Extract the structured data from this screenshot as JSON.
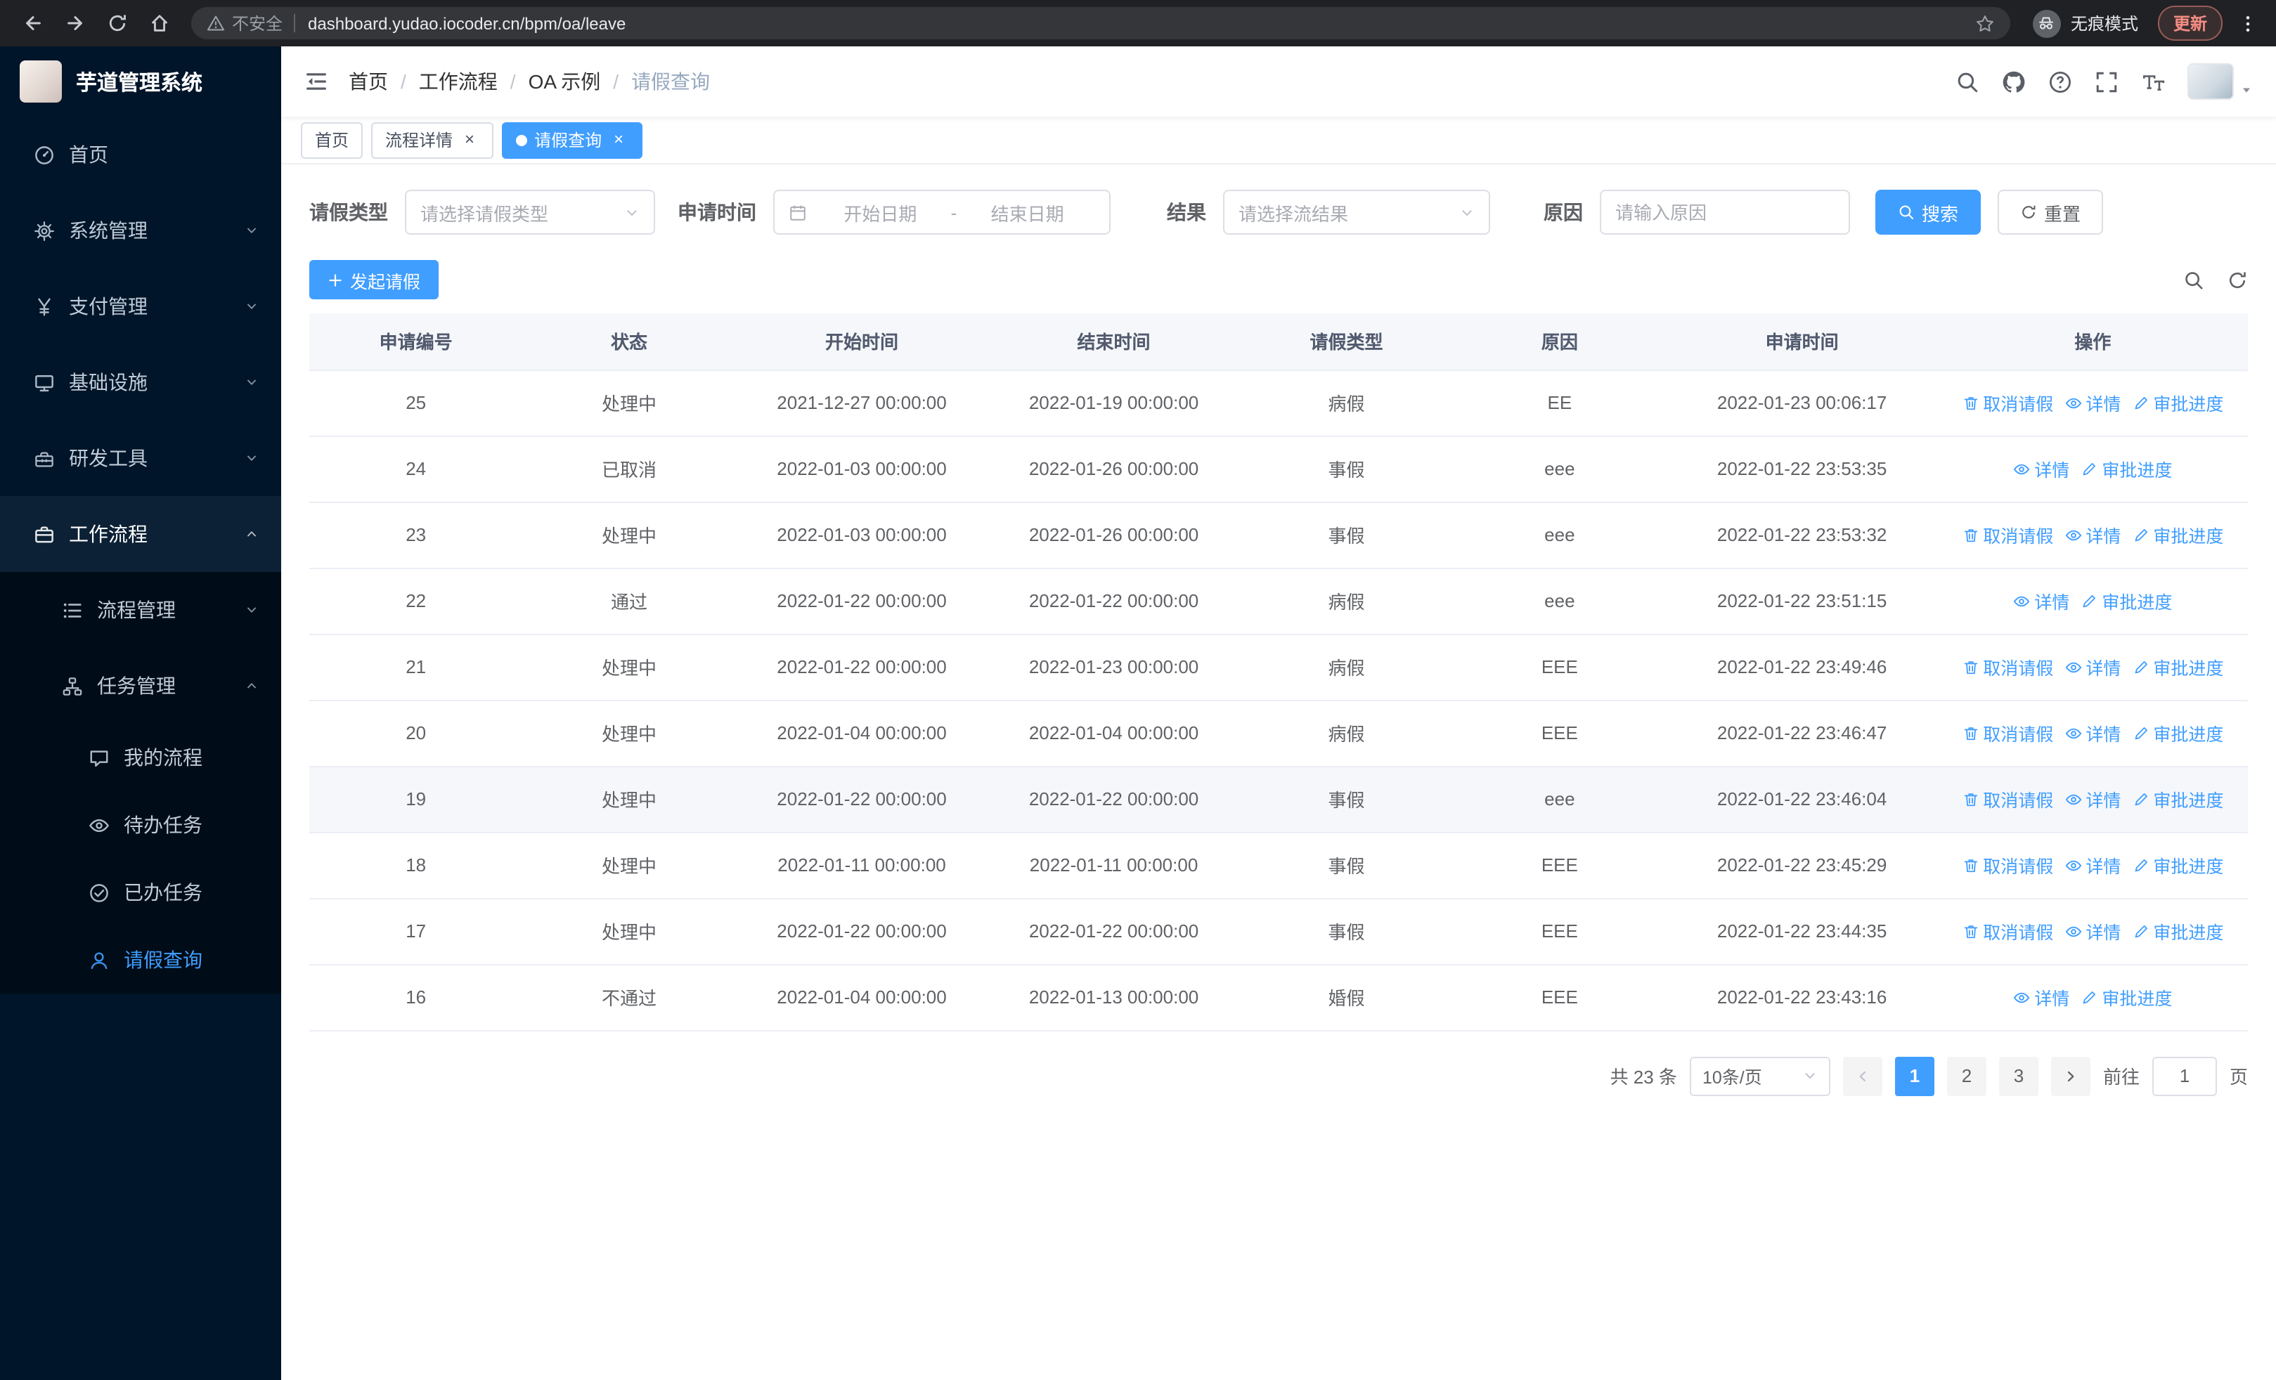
{
  "browser": {
    "security_label": "不安全",
    "url": "dashboard.yudao.iocoder.cn/bpm/oa/leave",
    "incognito_label": "无痕模式",
    "update_label": "更新"
  },
  "sidebar": {
    "brand": "芋道管理系统",
    "items": [
      {
        "id": "home",
        "label": "首页",
        "icon": "dashboard",
        "level": 1
      },
      {
        "id": "system",
        "label": "系统管理",
        "icon": "gear",
        "level": 1,
        "chevron": "down"
      },
      {
        "id": "payment",
        "label": "支付管理",
        "icon": "yen",
        "level": 1,
        "chevron": "down"
      },
      {
        "id": "infrastructure",
        "label": "基础设施",
        "icon": "infra",
        "level": 1,
        "chevron": "down"
      },
      {
        "id": "devtools",
        "label": "研发工具",
        "icon": "tools",
        "level": 1,
        "chevron": "down"
      },
      {
        "id": "workflow",
        "label": "工作流程",
        "icon": "workflow",
        "level": 1,
        "chevron": "up",
        "open": true
      },
      {
        "id": "process-mgmt",
        "label": "流程管理",
        "icon": "process",
        "level": 2,
        "chevron": "down"
      },
      {
        "id": "task-mgmt",
        "label": "任务管理",
        "icon": "task",
        "level": 2,
        "chevron": "up"
      },
      {
        "id": "my-process",
        "label": "我的流程",
        "icon": "chat",
        "level": 3
      },
      {
        "id": "todo-task",
        "label": "待办任务",
        "icon": "eye",
        "level": 3
      },
      {
        "id": "done-task",
        "label": "已办任务",
        "icon": "done",
        "level": 3
      },
      {
        "id": "leave-query",
        "label": "请假查询",
        "icon": "user",
        "level": 3,
        "active": true
      }
    ]
  },
  "navbar": {
    "breadcrumb": [
      "首页",
      "工作流程",
      "OA 示例",
      "请假查询"
    ]
  },
  "tabs": [
    {
      "id": "home",
      "label": "首页",
      "closable": false,
      "active": false
    },
    {
      "id": "process-detail",
      "label": "流程详情",
      "closable": true,
      "active": false
    },
    {
      "id": "leave-query",
      "label": "请假查询",
      "closable": true,
      "active": true
    }
  ],
  "filters": {
    "leave_type_label": "请假类型",
    "leave_type_placeholder": "请选择请假类型",
    "apply_time_label": "申请时间",
    "start_placeholder": "开始日期",
    "range_separator": "-",
    "end_placeholder": "结束日期",
    "result_label": "结果",
    "result_placeholder": "请选择流结果",
    "reason_label": "原因",
    "reason_placeholder": "请输入原因",
    "search_label": "搜索",
    "reset_label": "重置"
  },
  "toolbar": {
    "create_label": "发起请假"
  },
  "table": {
    "columns": [
      "申请编号",
      "状态",
      "开始时间",
      "结束时间",
      "请假类型",
      "原因",
      "申请时间",
      "操作"
    ],
    "action_labels": {
      "cancel": "取消请假",
      "detail": "详情",
      "progress": "审批进度"
    },
    "action_icons": {
      "cancel": "delete-icon",
      "detail": "eye-icon",
      "progress": "edit-icon"
    },
    "rows": [
      {
        "id": "25",
        "status": "处理中",
        "start": "2021-12-27 00:00:00",
        "end": "2022-01-19 00:00:00",
        "type": "病假",
        "reason": "EE",
        "apply_time": "2022-01-23 00:06:17",
        "actions": [
          "cancel",
          "detail",
          "progress"
        ]
      },
      {
        "id": "24",
        "status": "已取消",
        "start": "2022-01-03 00:00:00",
        "end": "2022-01-26 00:00:00",
        "type": "事假",
        "reason": "eee",
        "apply_time": "2022-01-22 23:53:35",
        "actions": [
          "detail",
          "progress"
        ]
      },
      {
        "id": "23",
        "status": "处理中",
        "start": "2022-01-03 00:00:00",
        "end": "2022-01-26 00:00:00",
        "type": "事假",
        "reason": "eee",
        "apply_time": "2022-01-22 23:53:32",
        "actions": [
          "cancel",
          "detail",
          "progress"
        ]
      },
      {
        "id": "22",
        "status": "通过",
        "start": "2022-01-22 00:00:00",
        "end": "2022-01-22 00:00:00",
        "type": "病假",
        "reason": "eee",
        "apply_time": "2022-01-22 23:51:15",
        "actions": [
          "detail",
          "progress"
        ]
      },
      {
        "id": "21",
        "status": "处理中",
        "start": "2022-01-22 00:00:00",
        "end": "2022-01-23 00:00:00",
        "type": "病假",
        "reason": "EEE",
        "apply_time": "2022-01-22 23:49:46",
        "actions": [
          "cancel",
          "detail",
          "progress"
        ]
      },
      {
        "id": "20",
        "status": "处理中",
        "start": "2022-01-04 00:00:00",
        "end": "2022-01-04 00:00:00",
        "type": "病假",
        "reason": "EEE",
        "apply_time": "2022-01-22 23:46:47",
        "actions": [
          "cancel",
          "detail",
          "progress"
        ]
      },
      {
        "id": "19",
        "status": "处理中",
        "start": "2022-01-22 00:00:00",
        "end": "2022-01-22 00:00:00",
        "type": "事假",
        "reason": "eee",
        "apply_time": "2022-01-22 23:46:04",
        "actions": [
          "cancel",
          "detail",
          "progress"
        ],
        "highlighted": true
      },
      {
        "id": "18",
        "status": "处理中",
        "start": "2022-01-11 00:00:00",
        "end": "2022-01-11 00:00:00",
        "type": "事假",
        "reason": "EEE",
        "apply_time": "2022-01-22 23:45:29",
        "actions": [
          "cancel",
          "detail",
          "progress"
        ]
      },
      {
        "id": "17",
        "status": "处理中",
        "start": "2022-01-22 00:00:00",
        "end": "2022-01-22 00:00:00",
        "type": "事假",
        "reason": "EEE",
        "apply_time": "2022-01-22 23:44:35",
        "actions": [
          "cancel",
          "detail",
          "progress"
        ]
      },
      {
        "id": "16",
        "status": "不通过",
        "start": "2022-01-04 00:00:00",
        "end": "2022-01-13 00:00:00",
        "type": "婚假",
        "reason": "EEE",
        "apply_time": "2022-01-22 23:43:16",
        "actions": [
          "detail",
          "progress"
        ]
      }
    ]
  },
  "pagination": {
    "total_label": "共 23 条",
    "page_size_label": "10条/页",
    "pages": [
      "1",
      "2",
      "3"
    ],
    "active_page": "1",
    "goto_label": "前往",
    "goto_value": "1",
    "page_unit_label": "页"
  },
  "colors": {
    "primary": "#409eff",
    "sidebar_bg": "#001529",
    "chrome_bg": "#202124"
  }
}
